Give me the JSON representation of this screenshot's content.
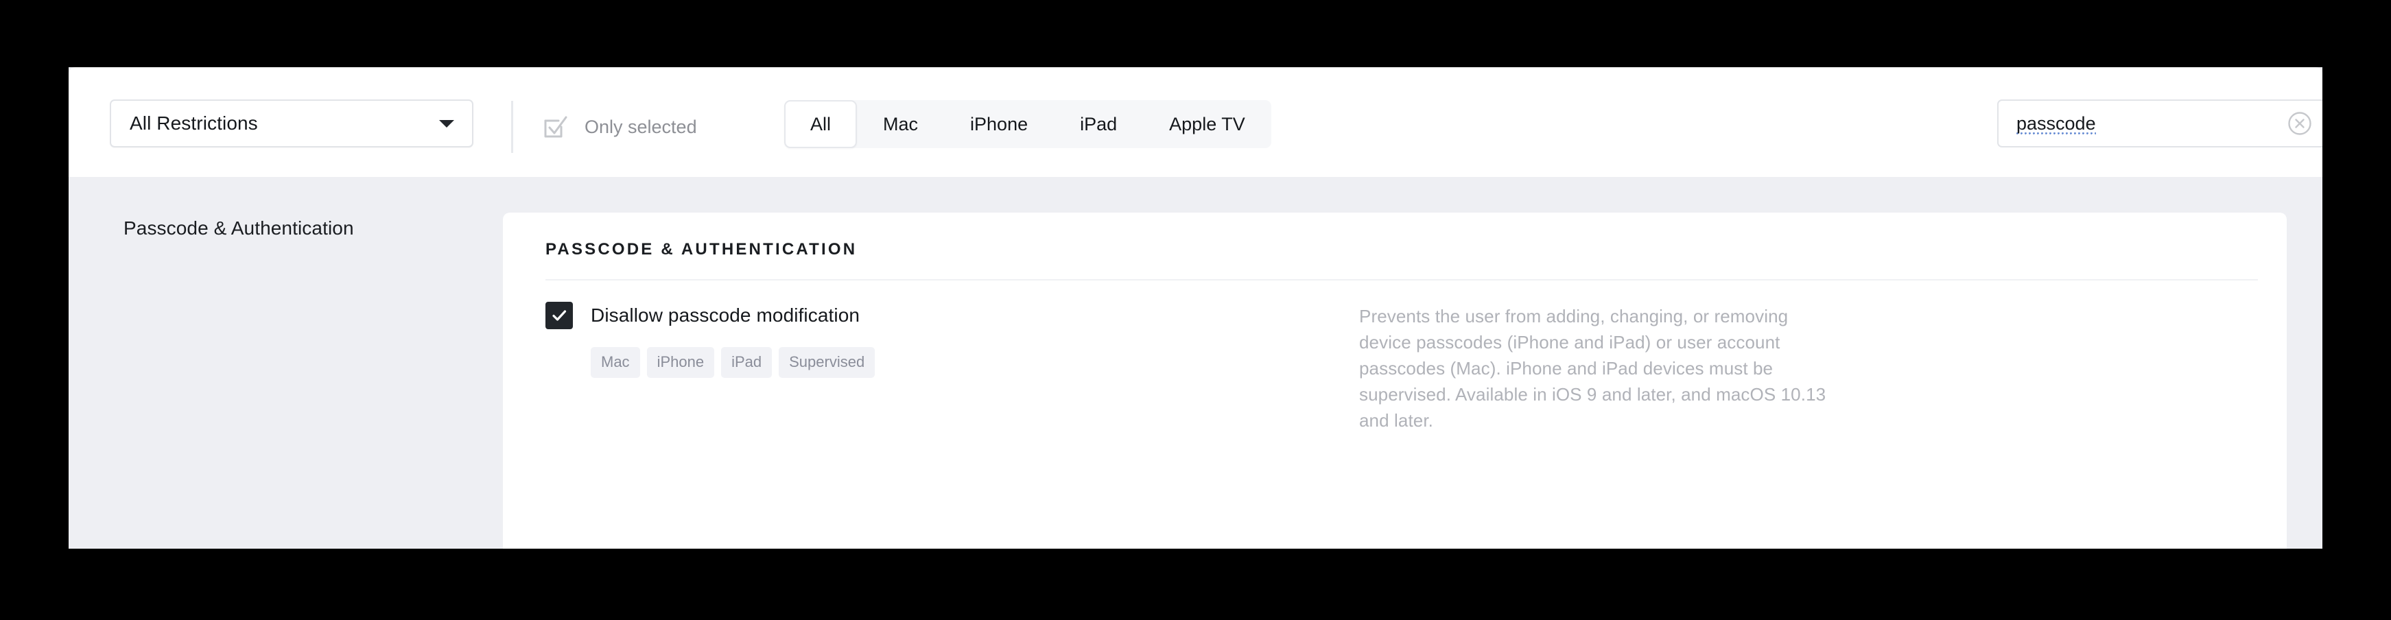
{
  "toolbar": {
    "filter_dropdown": {
      "selected": "All Restrictions",
      "caret_icon": "chevron-down-icon"
    },
    "only_selected": {
      "label": "Only selected",
      "checked": false,
      "icon": "checkbox-outline-icon"
    },
    "platform_segments": [
      {
        "label": "All",
        "active": true
      },
      {
        "label": "Mac",
        "active": false
      },
      {
        "label": "iPhone",
        "active": false
      },
      {
        "label": "iPad",
        "active": false
      },
      {
        "label": "Apple TV",
        "active": false
      }
    ],
    "search": {
      "value": "passcode",
      "placeholder": "Search",
      "clear_icon": "clear-circle-icon"
    }
  },
  "sidebar": {
    "items": [
      {
        "label": "Passcode & Authentication",
        "selected": true
      }
    ]
  },
  "content": {
    "section_title": "PASSCODE & AUTHENTICATION",
    "settings": [
      {
        "label": "Disallow passcode modification",
        "checked": true,
        "tags": [
          "Mac",
          "iPhone",
          "iPad",
          "Supervised"
        ],
        "description": "Prevents the user from adding, changing, or removing device passcodes (iPhone and iPad) or user account passcodes (Mac). iPhone and iPad devices must be supervised. Available in iOS 9 and later, and macOS 10.13 and later."
      }
    ]
  },
  "colors": {
    "panel_background": "#eeeff3",
    "card_background": "#ffffff",
    "checkbox_checked": "#22262b",
    "tag_background": "#f1f2f6",
    "tag_text": "#8a8d99",
    "muted_text": "#b0b2b8",
    "border": "#e2e4e8"
  }
}
